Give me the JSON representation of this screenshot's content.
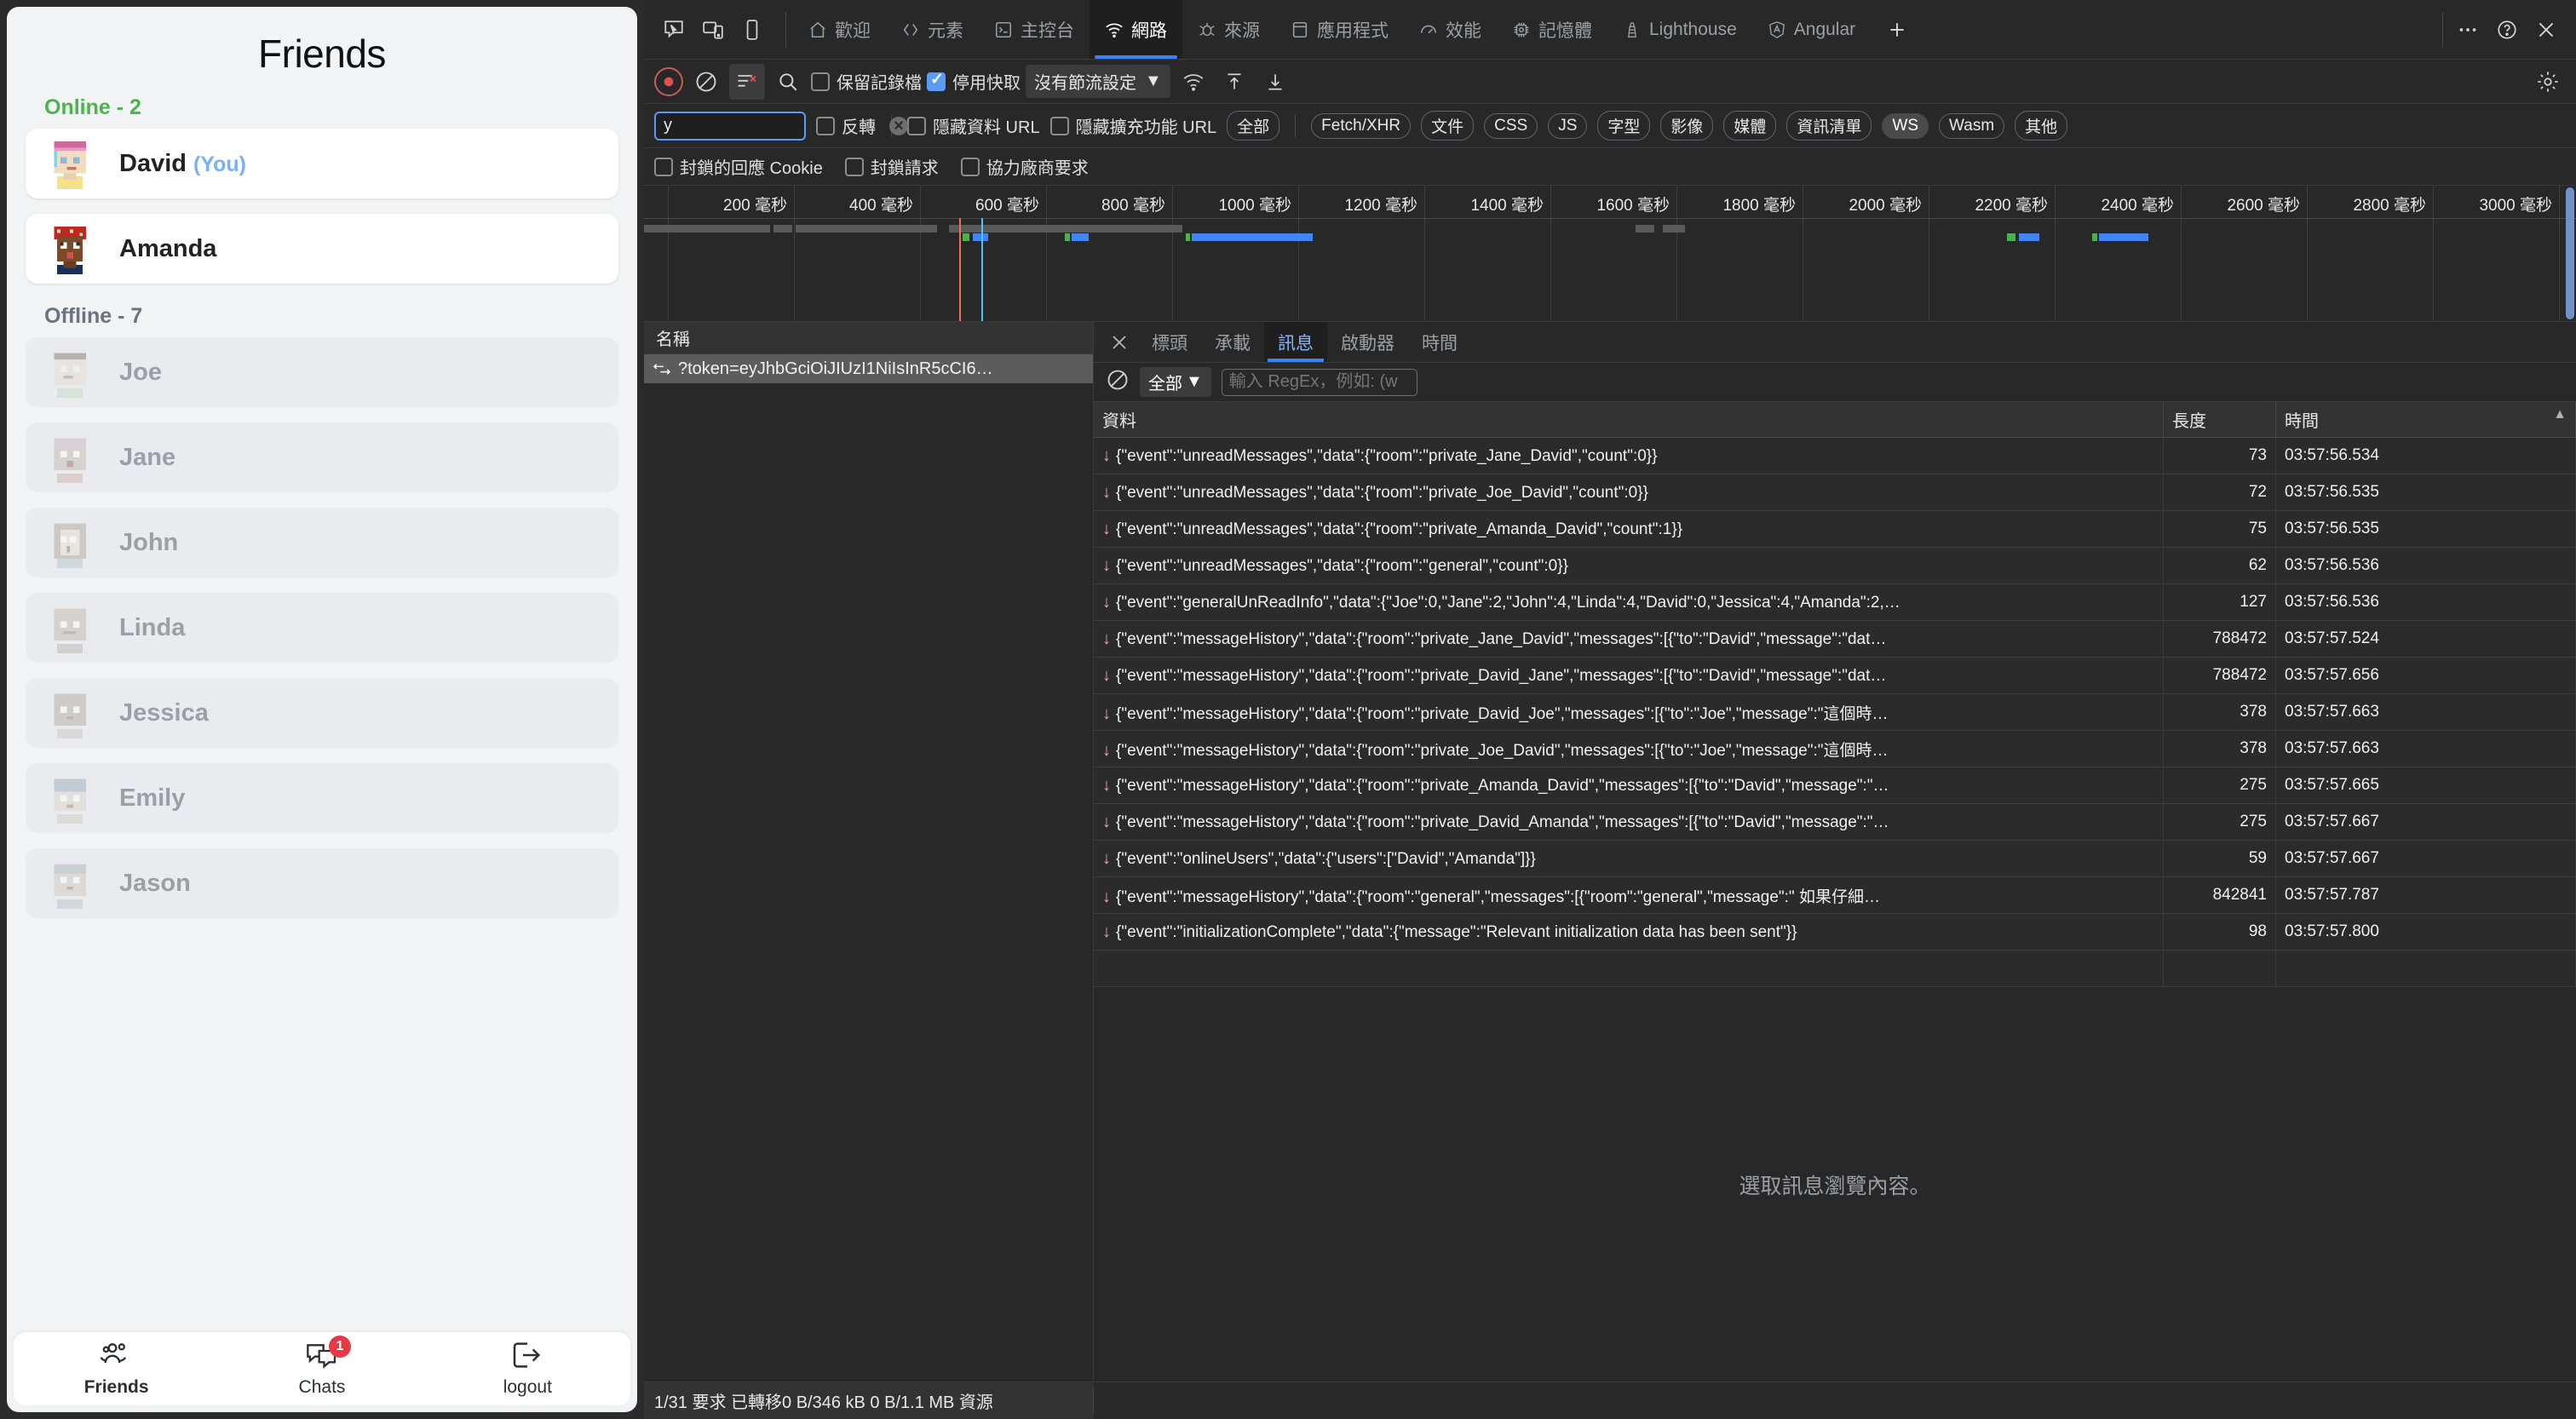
{
  "app": {
    "title": "Friends",
    "groups": [
      {
        "label": "Online - 2",
        "state": "online"
      },
      {
        "label": "Offline - 7",
        "state": "offline"
      }
    ],
    "online": [
      {
        "name": "David",
        "tag": "(You)"
      },
      {
        "name": "Amanda",
        "tag": ""
      }
    ],
    "offline": [
      {
        "name": "Joe"
      },
      {
        "name": "Jane"
      },
      {
        "name": "John"
      },
      {
        "name": "Linda"
      },
      {
        "name": "Jessica"
      },
      {
        "name": "Emily"
      },
      {
        "name": "Jason"
      }
    ],
    "nav": [
      {
        "label": "Friends",
        "icon": "friends-icon",
        "badge": ""
      },
      {
        "label": "Chats",
        "icon": "chats-icon",
        "badge": "1"
      },
      {
        "label": "logout",
        "icon": "logout-icon",
        "badge": ""
      }
    ],
    "colors": {
      "online": "#4bb54b",
      "offline": "#6b7280",
      "badge": "#e63946",
      "you": "#7ab0f5"
    }
  },
  "devtools": {
    "tabs": [
      {
        "label": "歡迎",
        "icon": "home-icon",
        "selected": false
      },
      {
        "label": "元素",
        "icon": "code-icon",
        "selected": false
      },
      {
        "label": "主控台",
        "icon": "console-icon",
        "selected": false
      },
      {
        "label": "網路",
        "icon": "network-icon",
        "selected": true
      },
      {
        "label": "來源",
        "icon": "sources-icon",
        "selected": false
      },
      {
        "label": "應用程式",
        "icon": "application-icon",
        "selected": false
      },
      {
        "label": "效能",
        "icon": "performance-icon",
        "selected": false
      },
      {
        "label": "記憶體",
        "icon": "memory-icon",
        "selected": false
      },
      {
        "label": "Lighthouse",
        "icon": "lighthouse-icon",
        "selected": false
      },
      {
        "label": "Angular",
        "icon": "angular-icon",
        "selected": false
      }
    ],
    "toolbar": {
      "preserve_log_label": "保留記錄檔",
      "preserve_log_checked": false,
      "disable_cache_label": "停用快取",
      "disable_cache_checked": true,
      "throttling_label": "沒有節流設定"
    },
    "filter": {
      "value": "y",
      "invert_label": "反轉",
      "hide_data_urls_label": "隱藏資料 URL",
      "hide_ext_urls_label": "隱藏擴充功能 URL",
      "types": [
        {
          "label": "全部",
          "active": false
        },
        {
          "label": "Fetch/XHR",
          "active": false
        },
        {
          "label": "文件",
          "active": false
        },
        {
          "label": "CSS",
          "active": false
        },
        {
          "label": "JS",
          "active": false
        },
        {
          "label": "字型",
          "active": false
        },
        {
          "label": "影像",
          "active": false
        },
        {
          "label": "媒體",
          "active": false
        },
        {
          "label": "資訊清單",
          "active": false
        },
        {
          "label": "WS",
          "active": true
        },
        {
          "label": "Wasm",
          "active": false
        },
        {
          "label": "其他",
          "active": false
        }
      ]
    },
    "blocked": [
      {
        "label": "封鎖的回應 Cookie",
        "checked": false
      },
      {
        "label": "封鎖請求",
        "checked": false
      },
      {
        "label": "協力廠商要求",
        "checked": false
      }
    ],
    "overview": {
      "ticks": [
        "200 毫秒",
        "400 毫秒",
        "600 毫秒",
        "800 毫秒",
        "1000 毫秒",
        "1200 毫秒",
        "1400 毫秒",
        "1600 毫秒",
        "1800 毫秒",
        "2000 毫秒",
        "2200 毫秒",
        "2400 毫秒",
        "2600 毫秒",
        "2800 毫秒",
        "3000 毫秒"
      ],
      "dclcolor": "#ef7058",
      "loadcolor": "#4fc3f7"
    },
    "requests": {
      "column": "名稱",
      "rows": [
        {
          "name": "?token=eyJhbGciOiJIUzI1NiIsInR5cCI6…",
          "icon": "websocket-icon",
          "selected": true
        }
      ]
    },
    "detail": {
      "tabs": [
        {
          "label": "標頭",
          "selected": false
        },
        {
          "label": "承載",
          "selected": false
        },
        {
          "label": "訊息",
          "selected": true
        },
        {
          "label": "啟動器",
          "selected": false
        },
        {
          "label": "時間",
          "selected": false
        }
      ],
      "all_dropdown": "全部",
      "regex_placeholder": "輸入 RegEx，例如: (w",
      "columns": [
        "資料",
        "長度",
        "時間"
      ],
      "empty_text": "選取訊息瀏覽內容。",
      "messages": [
        {
          "dir": "down",
          "data": "{\"event\":\"unreadMessages\",\"data\":{\"room\":\"private_Jane_David\",\"count\":0}}",
          "length": "73",
          "time": "03:57:56.534"
        },
        {
          "dir": "down",
          "data": "{\"event\":\"unreadMessages\",\"data\":{\"room\":\"private_Joe_David\",\"count\":0}}",
          "length": "72",
          "time": "03:57:56.535"
        },
        {
          "dir": "down",
          "data": "{\"event\":\"unreadMessages\",\"data\":{\"room\":\"private_Amanda_David\",\"count\":1}}",
          "length": "75",
          "time": "03:57:56.535"
        },
        {
          "dir": "down",
          "data": "{\"event\":\"unreadMessages\",\"data\":{\"room\":\"general\",\"count\":0}}",
          "length": "62",
          "time": "03:57:56.536"
        },
        {
          "dir": "down",
          "data": "{\"event\":\"generalUnReadInfo\",\"data\":{\"Joe\":0,\"Jane\":2,\"John\":4,\"Linda\":4,\"David\":0,\"Jessica\":4,\"Amanda\":2,…",
          "length": "127",
          "time": "03:57:56.536"
        },
        {
          "dir": "down",
          "data": "{\"event\":\"messageHistory\",\"data\":{\"room\":\"private_Jane_David\",\"messages\":[{\"to\":\"David\",\"message\":\"dat…",
          "length": "788472",
          "time": "03:57:57.524"
        },
        {
          "dir": "down",
          "data": "{\"event\":\"messageHistory\",\"data\":{\"room\":\"private_David_Jane\",\"messages\":[{\"to\":\"David\",\"message\":\"dat…",
          "length": "788472",
          "time": "03:57:57.656"
        },
        {
          "dir": "down",
          "data": "{\"event\":\"messageHistory\",\"data\":{\"room\":\"private_David_Joe\",\"messages\":[{\"to\":\"Joe\",\"message\":\"這個時…",
          "length": "378",
          "time": "03:57:57.663"
        },
        {
          "dir": "down",
          "data": "{\"event\":\"messageHistory\",\"data\":{\"room\":\"private_Joe_David\",\"messages\":[{\"to\":\"Joe\",\"message\":\"這個時…",
          "length": "378",
          "time": "03:57:57.663"
        },
        {
          "dir": "down",
          "data": "{\"event\":\"messageHistory\",\"data\":{\"room\":\"private_Amanda_David\",\"messages\":[{\"to\":\"David\",\"message\":\"…",
          "length": "275",
          "time": "03:57:57.665"
        },
        {
          "dir": "down",
          "data": "{\"event\":\"messageHistory\",\"data\":{\"room\":\"private_David_Amanda\",\"messages\":[{\"to\":\"David\",\"message\":\"…",
          "length": "275",
          "time": "03:57:57.667"
        },
        {
          "dir": "down",
          "data": "{\"event\":\"onlineUsers\",\"data\":{\"users\":[\"David\",\"Amanda\"]}}",
          "length": "59",
          "time": "03:57:57.667"
        },
        {
          "dir": "down",
          "data": "{\"event\":\"messageHistory\",\"data\":{\"room\":\"general\",\"messages\":[{\"room\":\"general\",\"message\":\" 如果仔細…",
          "length": "842841",
          "time": "03:57:57.787"
        },
        {
          "dir": "down",
          "data": "{\"event\":\"initializationComplete\",\"data\":{\"message\":\"Relevant initialization data has been sent\"}}",
          "length": "98",
          "time": "03:57:57.800"
        }
      ]
    },
    "status": "1/31 要求  已轉移0 B/346 kB  0 B/1.1 MB 資源"
  }
}
